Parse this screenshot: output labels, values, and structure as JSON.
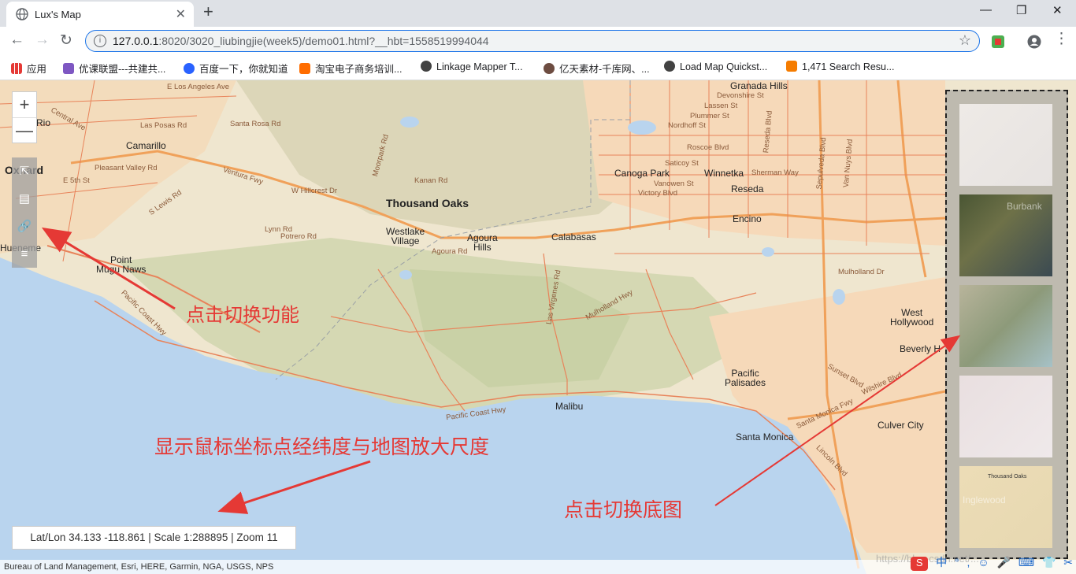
{
  "browser": {
    "tab_title": "Lux's Map",
    "tab_close": "✕",
    "new_tab": "+",
    "url_host": "127.0.0.1",
    "url_rest": ":8020/3020_liubingjie(week5)/demo01.html?__hbt=1558519994044",
    "window_minimize": "—",
    "window_restore": "❐",
    "window_close": "✕"
  },
  "bookmarks": [
    {
      "label": "应用",
      "color": "#4285f4"
    },
    {
      "label": "优课联盟---共建共...",
      "color": "#e53935"
    },
    {
      "label": "百度一下，你就知道",
      "color": "#2962ff"
    },
    {
      "label": "淘宝电子商务培训...",
      "color": "#ff6d00"
    },
    {
      "label": "Linkage Mapper T...",
      "color": "#424242"
    },
    {
      "label": "亿天素材-千库网、...",
      "color": "#6d4c41"
    },
    {
      "label": "Load Map Quickst...",
      "color": "#424242"
    },
    {
      "label": "1,471 Search Resu...",
      "color": "#f57c00"
    }
  ],
  "map": {
    "places": [
      {
        "name": "Thousand Oaks",
        "cls": "big"
      },
      {
        "name": "Oxnard",
        "cls": "big"
      },
      {
        "name": "Camarillo",
        "cls": "mid"
      },
      {
        "name": "Westlake\nVillage",
        "cls": "mid"
      },
      {
        "name": "Agoura\nHills",
        "cls": "mid"
      },
      {
        "name": "Calabasas",
        "cls": "mid"
      },
      {
        "name": "Canoga Park",
        "cls": "mid"
      },
      {
        "name": "Winnetka",
        "cls": "mid"
      },
      {
        "name": "Reseda",
        "cls": "mid"
      },
      {
        "name": "Encino",
        "cls": "mid"
      },
      {
        "name": "Point\nMugu Naws",
        "cls": "mid"
      },
      {
        "name": "Malibu",
        "cls": "mid"
      },
      {
        "name": "Pacific\nPalisades",
        "cls": "mid"
      },
      {
        "name": "Santa Monica",
        "cls": "mid"
      },
      {
        "name": "Culver City",
        "cls": "mid"
      },
      {
        "name": "West\nHollywood",
        "cls": "mid"
      },
      {
        "name": "Beverly H",
        "cls": "mid"
      },
      {
        "name": "Granada Hills",
        "cls": "mid"
      },
      {
        "name": "Rio",
        "cls": "mid"
      },
      {
        "name": "Hueneme",
        "cls": "mid"
      }
    ],
    "roads": [
      "E Los Angeles Ave",
      "Central Ave",
      "Las Posas Rd",
      "Santa Rosa Rd",
      "Pleasant Valley Rd",
      "E 5th St",
      "S Lewis Rd",
      "Ventura Fwy",
      "W Hillcrest Dr",
      "Lynn Rd",
      "Potrero Rd",
      "Agoura Rd",
      "Pacific Coast Hwy",
      "Mulholland Hwy",
      "Las Virgenes Rd",
      "Victory Blvd",
      "Vanowen St",
      "Saticoy St",
      "Sherman Way",
      "Roscoe Blvd",
      "Nordhoff St",
      "Plummer St",
      "Lassen St",
      "Devonshire St",
      "Sepulveda Blvd",
      "Van Nuys Blvd",
      "Wilshire Blvd",
      "Santa Monica Fwy",
      "Lincoln Blvd",
      "Sunset Blvd",
      "Pacific Coast Hwy",
      "Mulholland Dr",
      "Reseda Blvd",
      "Kanan Rd",
      "Moorpark Rd"
    ],
    "zoom_in": "+",
    "zoom_out": "—",
    "tools": [
      "⇱",
      "▤",
      "🔗",
      "≡"
    ],
    "coords": "Lat/Lon 34.133 -118.861 | Scale 1:288895 | Zoom 11",
    "attribution": "Bureau of Land Management, Esri, HERE, Garmin, NGA, USGS, NPS",
    "basemap_thumbs": [
      {
        "label": "",
        "bg": "linear-gradient(135deg,#eeeae6,#e7e3e1)"
      },
      {
        "label": "Burbank",
        "bg": "linear-gradient(135deg,#4a5634,#6e7148 40%,#3b4a52)"
      },
      {
        "label": "",
        "bg": "linear-gradient(135deg,#b8b49b,#8d9a7a 50%,#a6c1c6)"
      },
      {
        "label": "",
        "bg": "linear-gradient(135deg,#e9dfe0,#efe9ea)"
      },
      {
        "label": "Inglewood",
        "bg": "linear-gradient(135deg,#ecdcb6,#e7d8b1)"
      }
    ],
    "thumb5_caption": "Thousand Oaks"
  },
  "annotations": {
    "switch_function": "点击切换功能",
    "show_coords": "显示鼠标坐标点经纬度与地图放大尺度",
    "switch_basemap": "点击切换底图"
  },
  "tray": {
    "items": [
      "中",
      "°",
      ",",
      "☺",
      "🎤",
      "⌨",
      "👕",
      "✂"
    ],
    "watermark": "https://blog.csdn.net/..."
  },
  "colors": {
    "annotation": "#e53935",
    "water": "#b9d4ee",
    "land": "#efe6cf",
    "road": "#e8835a",
    "highway": "#f0a15a",
    "urban": "#f6d9b9"
  }
}
